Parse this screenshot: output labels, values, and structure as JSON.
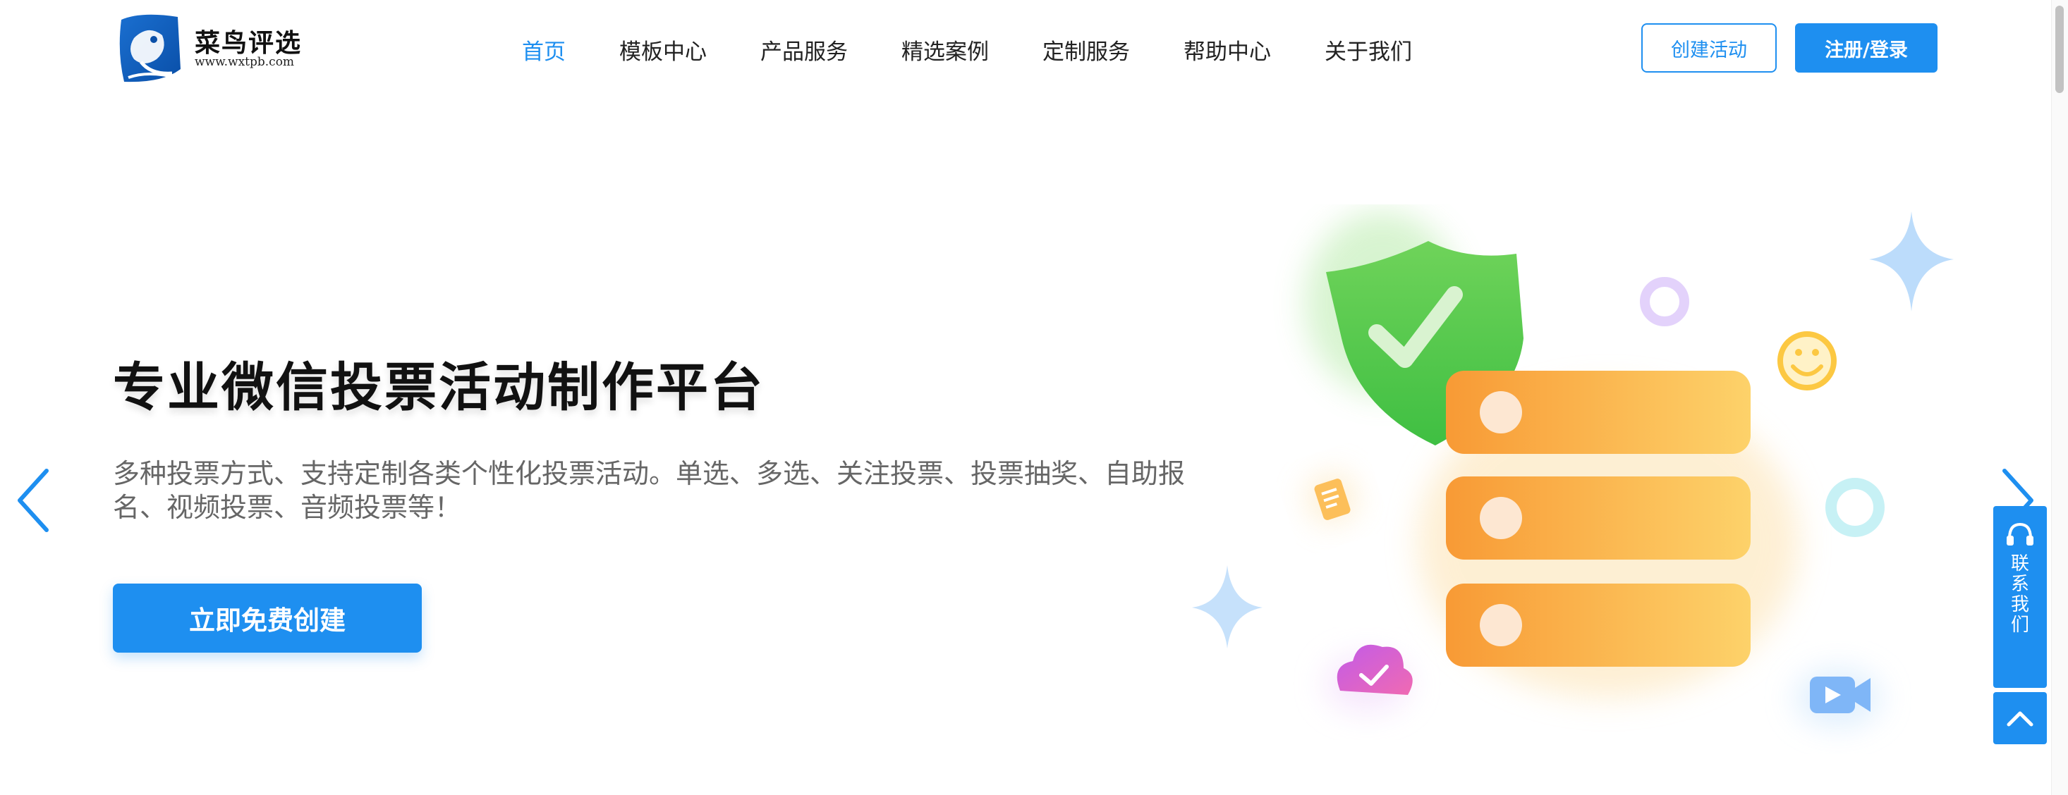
{
  "brand": {
    "name": "菜鸟评选",
    "url": "www.wxtpb.com",
    "primary_color": "#1e8ff0"
  },
  "nav": {
    "items": [
      {
        "label": "首页",
        "active": true
      },
      {
        "label": "模板中心",
        "active": false
      },
      {
        "label": "产品服务",
        "active": false
      },
      {
        "label": "精选案例",
        "active": false
      },
      {
        "label": "定制服务",
        "active": false
      },
      {
        "label": "帮助中心",
        "active": false
      },
      {
        "label": "关于我们",
        "active": false
      }
    ]
  },
  "header_actions": {
    "create_label": "创建活动",
    "login_label": "注册/登录"
  },
  "hero": {
    "title": "专业微信投票活动制作平台",
    "description": "多种投票方式、支持定制各类个性化投票活动。单选、多选、关注投票、投票抽奖、自助报名、视频投票、音频投票等！",
    "cta_label": "立即免费创建"
  },
  "carousel": {
    "prev_icon": "chevron-left-icon",
    "next_icon": "chevron-right-icon"
  },
  "side_float": {
    "contact_label": "联系我们",
    "contact_icon": "headset-icon",
    "top_icon": "chevron-up-icon"
  },
  "illustration": {
    "icons": [
      "shield-check-icon",
      "server-stack-icon",
      "smiley-icon",
      "ring-icon",
      "sparkle-icon",
      "cloud-check-icon",
      "video-icon",
      "note-icon"
    ]
  }
}
